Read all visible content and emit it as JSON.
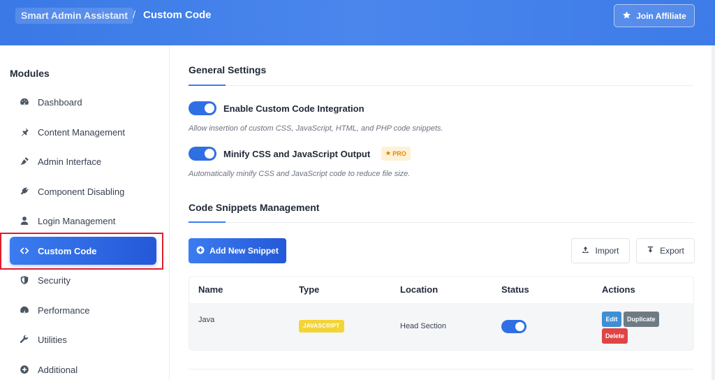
{
  "header": {
    "app_name": "Smart Admin Assistant",
    "separator": "/",
    "page_title": "Custom Code",
    "affiliate_button": "Join Affiliate"
  },
  "sidebar": {
    "title": "Modules",
    "items": [
      {
        "label": "Dashboard",
        "icon": "dashboard-icon"
      },
      {
        "label": "Content Management",
        "icon": "pin-icon"
      },
      {
        "label": "Admin Interface",
        "icon": "pen-icon"
      },
      {
        "label": "Component Disabling",
        "icon": "plug-icon"
      },
      {
        "label": "Login Management",
        "icon": "user-icon"
      },
      {
        "label": "Custom Code",
        "icon": "code-icon",
        "active": true
      },
      {
        "label": "Security",
        "icon": "shield-icon"
      },
      {
        "label": "Performance",
        "icon": "gauge-icon"
      },
      {
        "label": "Utilities",
        "icon": "wrench-icon"
      },
      {
        "label": "Additional",
        "icon": "plus-circle-icon"
      }
    ]
  },
  "general_settings": {
    "title": "General Settings",
    "options": [
      {
        "label": "Enable Custom Code Integration",
        "enabled": true,
        "help": "Allow insertion of custom CSS, JavaScript, HTML, and PHP code snippets."
      },
      {
        "label": "Minify CSS and JavaScript Output",
        "enabled": true,
        "badge": "PRO",
        "help": "Automatically minify CSS and JavaScript code to reduce file size."
      }
    ]
  },
  "snippets": {
    "title": "Code Snippets Management",
    "add_button": "Add New Snippet",
    "import_button": "Import",
    "export_button": "Export",
    "columns": [
      "Name",
      "Type",
      "Location",
      "Status",
      "Actions"
    ],
    "rows": [
      {
        "name": "Java",
        "type": "JAVASCRIPT",
        "location": "Head Section",
        "status": true,
        "actions": {
          "edit": "Edit",
          "duplicate": "Duplicate",
          "delete": "Delete"
        }
      }
    ]
  },
  "colors": {
    "accent": "#2f6fe4",
    "header_gradient_start": "#3a79e6",
    "pro_badge_bg": "#fff1d6",
    "pro_badge_text": "#d98a10",
    "type_badge": "#f2d437",
    "delete": "#e04545",
    "edit": "#3d8fd6",
    "duplicate": "#6f7b82",
    "highlight": "#e11d2e"
  }
}
